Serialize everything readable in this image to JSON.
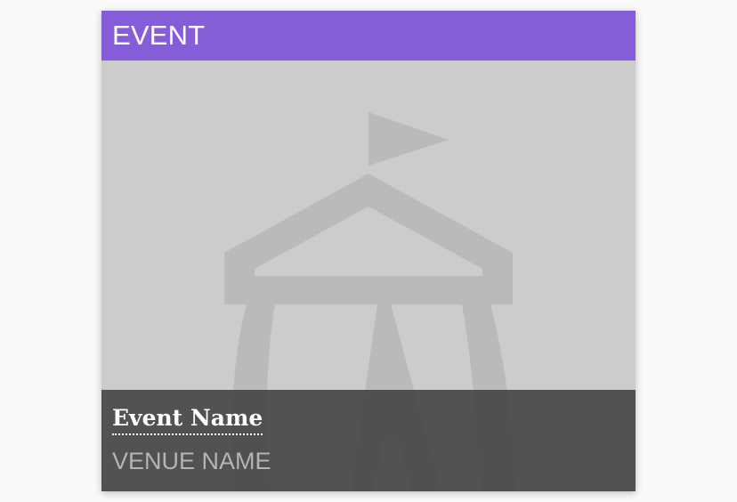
{
  "card": {
    "category_label": "EVENT",
    "event_name": "Event Name",
    "venue_name": "VENUE NAME",
    "placeholder_icon": "tent-icon",
    "accent_color": "#865dd8"
  }
}
